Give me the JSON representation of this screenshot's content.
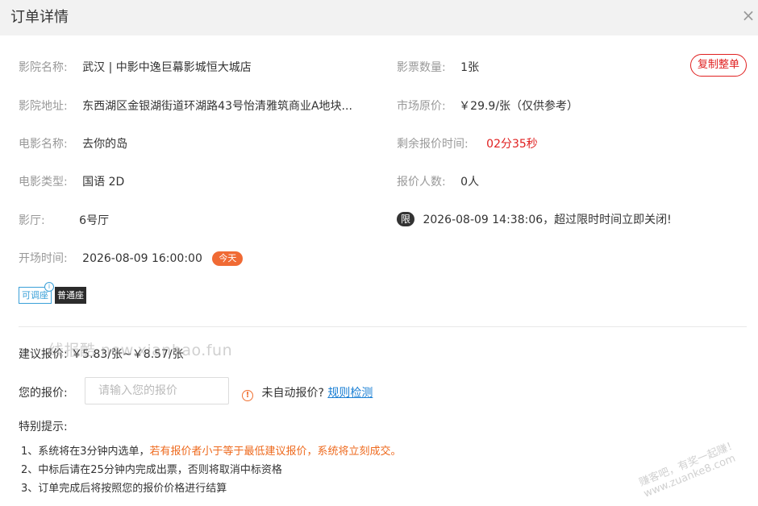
{
  "header": {
    "title": "订单详情",
    "close_glyph": "×"
  },
  "left": {
    "cinema_name_label": "影院名称:",
    "cinema_name": "武汉 | 中影中逸巨幕影城恒大城店",
    "cinema_addr_label": "影院地址:",
    "cinema_addr": "东西湖区金银湖街道环湖路43号怡清雅筑商业A地块...",
    "movie_name_label": "电影名称:",
    "movie_name": "去你的岛",
    "movie_type_label": "电影类型:",
    "movie_type": "国语 2D",
    "hall_label": "影厅:",
    "hall": "6号厅",
    "start_label": "开场时间:",
    "start_time": "2026-08-09 16:00:00",
    "today_badge": "今天"
  },
  "right": {
    "ticket_count_label": "影票数量:",
    "ticket_count": "1张",
    "market_price_label": "市场原价:",
    "market_price": "￥29.9/张（仅供参考）",
    "remain_label": "剩余报价时间:",
    "remain_time": "02分35秒",
    "bidders_label": "报价人数:",
    "bidders": "0人",
    "limit_badge": "限",
    "limit_text": "2026-08-09 14:38:06，超过限时时间立即关闭!"
  },
  "copy_button": "复制整单",
  "tags": {
    "adjustable": "可调座",
    "info_glyph": "i",
    "normal_seat": "普通座"
  },
  "suggest": {
    "label": "建议报价:",
    "value": "￥5.83/张~￥8.57/张"
  },
  "watermark": "线报酷 new.xianbao.fun",
  "watermark_corner": "赚客吧，有奖一起赚！ www.zuanke8.com",
  "bid": {
    "label": "您的报价:",
    "placeholder": "请输入您的报价",
    "warn_glyph": "!",
    "auto_text": "未自动报价?",
    "rule_link": "规则检测"
  },
  "tips": {
    "title": "特别提示:",
    "line1_a": "1、系统将在3分钟内选单，",
    "line1_b": "若有报价者小于等于最低建议报价，系统将立刻成交。",
    "line2": "2、中标后请在25分钟内完成出票，否则将取消中标资格",
    "line3": "3、订单完成后将按照您的报价价格进行结算"
  },
  "colors": {
    "accent_red": "#e02020",
    "link_blue": "#1a7fd4",
    "orange": "#ee6a1e",
    "tag_blue": "#3aa0d8"
  }
}
